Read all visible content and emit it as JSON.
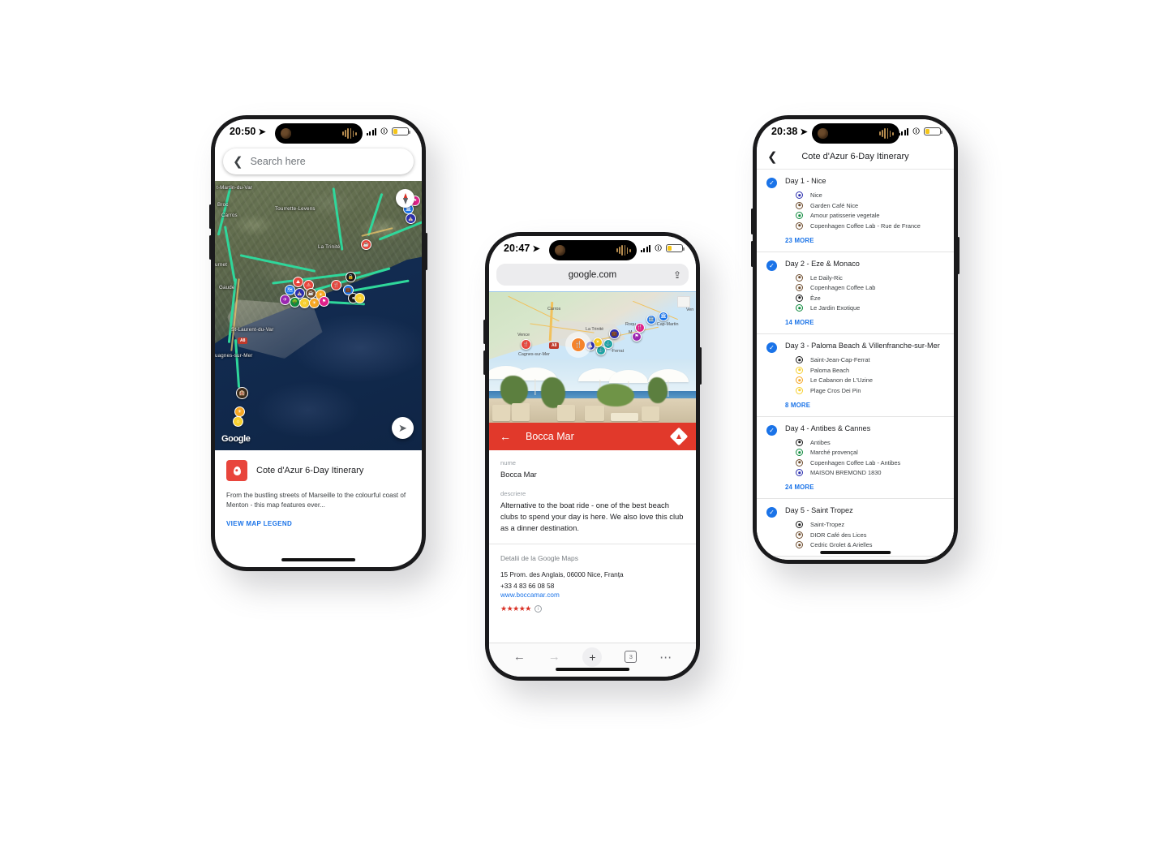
{
  "phone1": {
    "status": {
      "time": "20:50",
      "location_icon": "location-arrow-icon",
      "battery_icon": "battery-low-icon",
      "wifi_icon": "wifi-icon",
      "signal_icon": "cellular-signal-icon"
    },
    "search": {
      "back_icon": "chevron-left-icon",
      "placeholder": "Search here"
    },
    "map": {
      "attribution": "Google",
      "compass_icon": "compass-icon",
      "locate_icon": "my-location-icon",
      "labels": [
        "t-Martin-du-Var",
        "Broc",
        "Carros",
        "Tourrette-Levens",
        "La Trinité",
        "urnet",
        "Gaude",
        "St-Laurent-du-Var",
        "uagnes-sur-Mer",
        "A8"
      ]
    },
    "card": {
      "map_icon": "google-my-maps-icon",
      "title": "Cote d'Azur 6-Day Itinerary",
      "description": "From the bustling streets of Marseille to the colourful coast of Menton - this map features ever...",
      "legend_link": "VIEW MAP LEGEND"
    }
  },
  "phone2": {
    "status": {
      "time": "20:47",
      "location_icon": "location-arrow-icon"
    },
    "browser": {
      "url": "google.com",
      "share_icon": "share-icon"
    },
    "map": {
      "labels": [
        "Carros",
        "La Trinité",
        "Vence",
        "Cagnes-sur-Mer",
        "Roqu",
        "-Cap-Martin",
        "M",
        "-Ferrat",
        "Ven",
        "A8"
      ]
    },
    "appbar": {
      "back_icon": "arrow-left-icon",
      "title": "Bocca Mar",
      "directions_icon": "directions-icon"
    },
    "fields": [
      {
        "label": "nume",
        "value": "Bocca Mar"
      },
      {
        "label": "descriere",
        "value": "Alternative to the boat ride - one of the best beach clubs to spend your day is here. We also love this club as a dinner destination."
      }
    ],
    "details": {
      "heading": "Detalii de la Google Maps",
      "address": "15 Prom. des Anglais, 06000 Nice, Franța",
      "phone": "+33 4 83 66 08 58",
      "website": "www.boccamar.com",
      "rating_stars": "★★★★★",
      "info_icon": "info-icon"
    },
    "toolbar": {
      "back_icon": "arrow-left-icon",
      "forward_icon": "arrow-right-icon",
      "new_tab_icon": "plus-icon",
      "tab_count": "3",
      "more_icon": "ellipsis-icon"
    }
  },
  "phone3": {
    "status": {
      "time": "20:38",
      "location_icon": "location-arrow-icon"
    },
    "header": {
      "back_icon": "chevron-left-icon",
      "title": "Cote d'Azur 6-Day Itinerary"
    },
    "days": [
      {
        "checked_icon": "check-circle-icon",
        "title": "Day 1 - Nice",
        "more": "23 MORE",
        "places": [
          {
            "name": "Nice",
            "color": "#2b2fae"
          },
          {
            "name": "Garden Café Nice",
            "color": "#6b4a2b"
          },
          {
            "name": "Amour patisserie vegetale",
            "color": "#0f8a3d"
          },
          {
            "name": "Copenhagen Coffee Lab - Rue de France",
            "color": "#6b4a2b"
          }
        ]
      },
      {
        "checked_icon": "check-circle-icon",
        "title": "Day 2 - Eze & Monaco",
        "more": "14 MORE",
        "places": [
          {
            "name": "Le Daily-Ric",
            "color": "#6b4a2b"
          },
          {
            "name": "Copenhagen Coffee Lab",
            "color": "#6b4a2b"
          },
          {
            "name": "Èze",
            "color": "#1a1a1a"
          },
          {
            "name": "Le Jardin Exotique",
            "color": "#0f8a3d"
          }
        ]
      },
      {
        "checked_icon": "check-circle-icon",
        "title": "Day 3 - Paloma Beach & Villenfranche-sur-Mer",
        "more": "8 MORE",
        "places": [
          {
            "name": "Saint-Jean-Cap-Ferrat",
            "color": "#1a1a1a"
          },
          {
            "name": "Paloma Beach",
            "color": "#f7cf2e"
          },
          {
            "name": "Le Cabanon de L'Uzine",
            "color": "#f5a623"
          },
          {
            "name": "Plage Cros Dei Pin",
            "color": "#f7cf2e"
          }
        ]
      },
      {
        "checked_icon": "check-circle-icon",
        "title": "Day 4 - Antibes & Cannes",
        "more": "24 MORE",
        "places": [
          {
            "name": "Antibes",
            "color": "#1a1a1a"
          },
          {
            "name": "Marché provençal",
            "color": "#0f8a3d"
          },
          {
            "name": "Copenhagen Coffee Lab - Antibes",
            "color": "#6b4a2b"
          },
          {
            "name": "MAISON BREMOND 1830",
            "color": "#2b2fae"
          }
        ]
      },
      {
        "checked_icon": "check-circle-icon",
        "title": "Day 5 - Saint Tropez",
        "more": "",
        "places": [
          {
            "name": "Saint-Tropez",
            "color": "#1a1a1a"
          },
          {
            "name": "DIOR Café des Lices",
            "color": "#6b4a2b"
          },
          {
            "name": "Cedric Grolet & Arielles",
            "color": "#6b4a2b"
          }
        ]
      }
    ]
  }
}
